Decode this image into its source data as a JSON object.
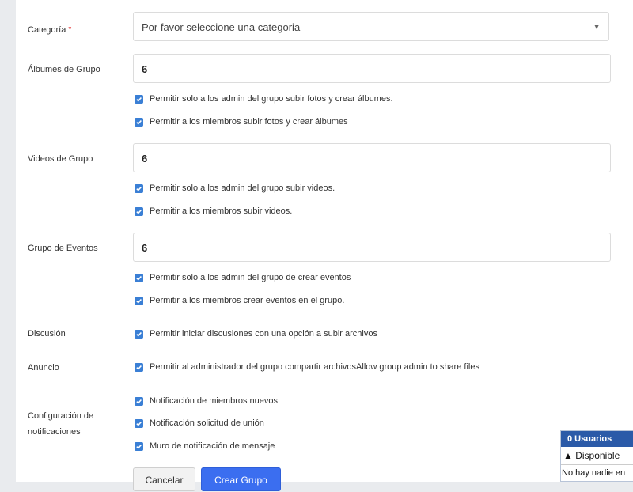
{
  "form": {
    "category": {
      "label": "Categoría",
      "required_mark": "*",
      "selected": "Por favor seleccione una categoria",
      "arrow": "▼"
    },
    "albums": {
      "label": "Álbumes de Grupo",
      "value": "6",
      "options": [
        "Permitir solo a los admin del grupo subir fotos y crear álbumes.",
        "Permitir a los miembros subir fotos y crear álbumes"
      ]
    },
    "videos": {
      "label": "Videos de Grupo",
      "value": "6",
      "options": [
        "Permitir solo a los admin del grupo subir videos.",
        "Permitir a los miembros subir videos."
      ]
    },
    "events": {
      "label": "Grupo de Eventos",
      "value": "6",
      "options": [
        "Permitir solo a los admin del grupo de crear eventos",
        "Permitir a los miembros crear eventos en el grupo."
      ]
    },
    "discussion": {
      "label": "Discusión",
      "option": "Permitir iniciar discusiones con una opción a subir archivos"
    },
    "announcement": {
      "label": "Anuncio",
      "option": "Permitir al administrador del grupo compartir archivosAllow group admin to share files"
    },
    "notifications": {
      "label_line1": "Configuración de",
      "label_line2": "notificaciones",
      "options": [
        "Notificación de miembros nuevos",
        "Notificación solicitud de unión",
        "Muro de notificación de mensaje"
      ]
    },
    "buttons": {
      "cancel": "Cancelar",
      "create": "Crear Grupo"
    }
  },
  "chat": {
    "header": "0 Usuarios",
    "status": "▲ Disponible",
    "empty": "No hay nadie en"
  },
  "colors": {
    "accent": "#3b6ef0",
    "checkbox": "#3a7fd5",
    "chat_header": "#2b5aa8"
  }
}
